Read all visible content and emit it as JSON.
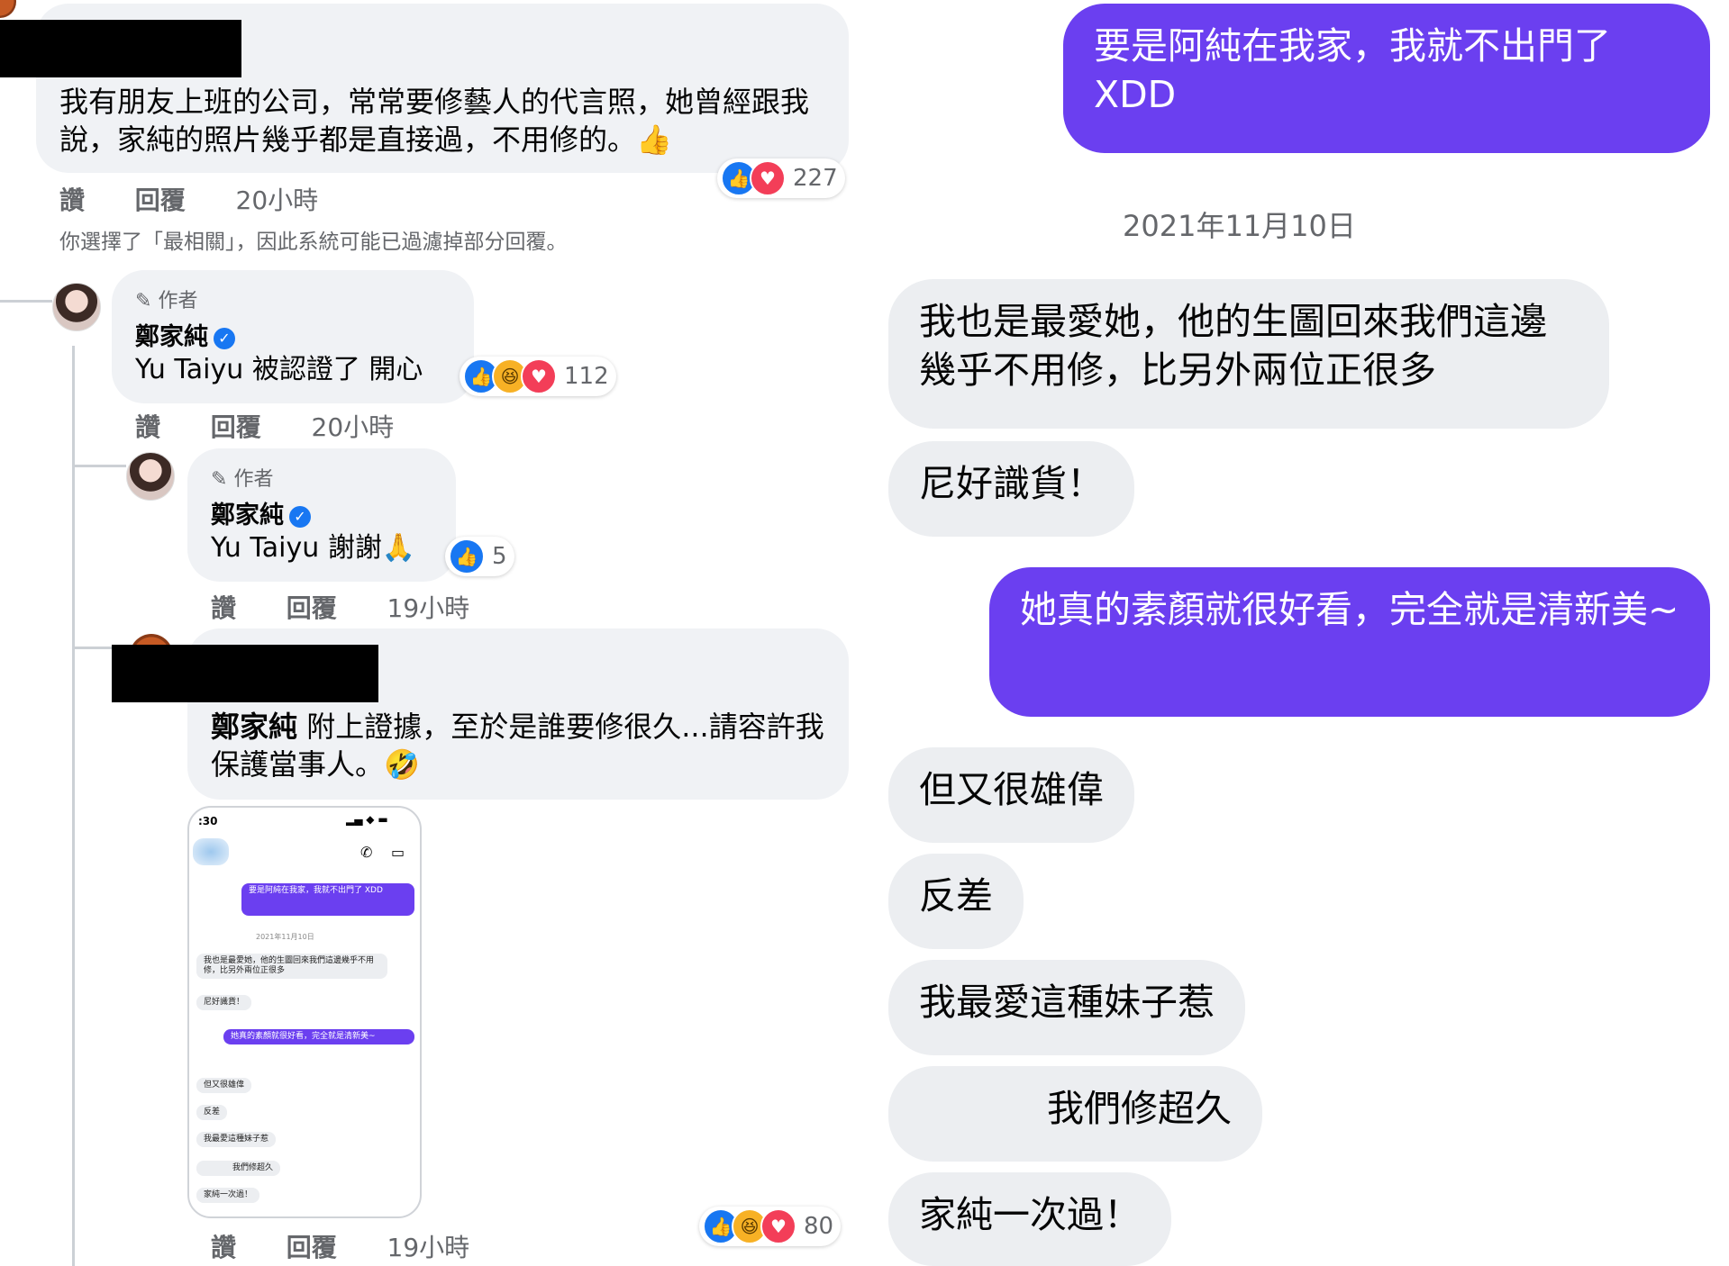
{
  "comments": {
    "top_comment": {
      "text": "我有朋友上班的公司，常常要修藝人的代言照，她曾經跟我說，家純的照片幾乎都是直接過，不用修的。",
      "emoji": "👍",
      "reaction_count": "227",
      "actions": {
        "like": "讚",
        "reply": "回覆",
        "time": "20小時"
      }
    },
    "filter_notice": "你選擇了「最相關」，因此系統可能已過濾掉部分回覆。",
    "reply1": {
      "author_tag": "作者",
      "name": "鄭家純",
      "text": "Yu Taiyu 被認證了 開心",
      "reaction_count": "112",
      "actions": {
        "like": "讚",
        "reply": "回覆",
        "time": "20小時"
      }
    },
    "reply2": {
      "author_tag": "作者",
      "name": "鄭家純",
      "text": "Yu Taiyu 謝謝",
      "emoji": "🙏",
      "reaction_count": "5",
      "actions": {
        "like": "讚",
        "reply": "回覆",
        "time": "19小時"
      }
    },
    "reply3": {
      "mention": "鄭家純",
      "text": " 附上證據，至於是誰要修很久...請容許我保護當事人。",
      "emoji": "🤣",
      "reaction_count": "80",
      "actions": {
        "like": "讚",
        "reply": "回覆",
        "time": "19小時"
      }
    },
    "mini_screenshot": {
      "status_time": ":30",
      "msg1": "要是阿純在我家，我就不出門了 XDD",
      "date": "2021年11月10日",
      "msg2": "我也是最愛她，他的生圖回來我們這邊幾乎不用修，比另外兩位正很多",
      "msg3": "尼好識貨！",
      "msg4": "她真的素顏就很好看，完全就是清新美~",
      "msg5": "但又很雄偉",
      "msg6": "反差",
      "msg7": "我最愛這種妹子惹",
      "msg8": "我們修超久",
      "msg9": "家純一次過！"
    }
  },
  "chat": {
    "messages": [
      {
        "side": "out",
        "text": "要是阿純在我家，我就不出門了 XDD"
      },
      {
        "side": "date",
        "text": "2021年11月10日"
      },
      {
        "side": "in",
        "text": "我也是最愛她，他的生圖回來我們這邊幾乎不用修，比另外兩位正很多"
      },
      {
        "side": "in",
        "text": "尼好識貨！"
      },
      {
        "side": "out",
        "text": "她真的素顏就很好看，完全就是清新美~"
      },
      {
        "side": "in",
        "text": "但又很雄偉"
      },
      {
        "side": "in",
        "text": "反差"
      },
      {
        "side": "in",
        "text": "我最愛這種妹子惹"
      },
      {
        "side": "in",
        "text": "我們修超久"
      },
      {
        "side": "in",
        "text": "家純一次過！"
      }
    ]
  },
  "colors": {
    "outgoing_bubble": "#6b3ff0",
    "incoming_bubble": "#eceef1",
    "comment_bubble": "#f0f2f5",
    "secondary_text": "#65676b",
    "facebook_blue": "#1877f2"
  }
}
